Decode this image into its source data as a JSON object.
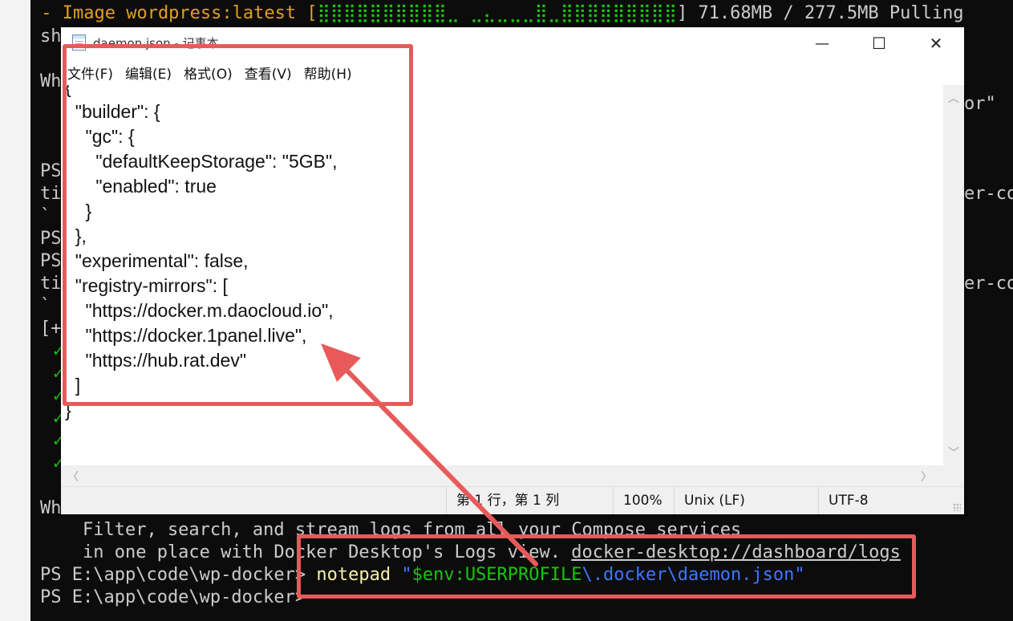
{
  "terminal": {
    "pull_line": {
      "prefix": " - Image wordpress:latest [",
      "bar": "⣿⣿⣿⣿⣿⣿⣿⣿⣿⣿⣀ ⣀⣄⣀⣀⣀⣿⣀⣿⣿⣿⣿⣿⣿⣿⣿⣿",
      "suffix": "] 71.68MB / 277.5MB Pulling"
    },
    "left_fragments": {
      "l1": "sh",
      "l2": "Wh",
      "l3": "PS",
      "l4": "ti",
      "l5": "`",
      "l6": "PS",
      "l7": "PS",
      "l8": "ti",
      "l9": "`",
      "l10": "[+",
      "l11": "Wh"
    },
    "right_fragments": {
      "r1": "or\"",
      "r2": "er-co",
      "r3": "er-co"
    },
    "tip_line1": "    Filter, search, and stream logs from all your Compose services",
    "tip_line2_text": "    in one place with Docker Desktop's Logs view. ",
    "tip_line2_link": "docker-desktop://dashboard/logs",
    "prompt": "PS E:\\app\\code\\wp-docker> ",
    "cmd_name": "notepad",
    "cmd_quote_open": " \"",
    "cmd_var": "$env:USERPROFILE",
    "cmd_path": "\\.docker\\daemon.json",
    "cmd_quote_close": "\"",
    "prompt2": "PS E:\\app\\code\\wp-docker>"
  },
  "notepad": {
    "title": "daemon.json - 记事本",
    "controls": {
      "minimize": "—",
      "maximize": "☐",
      "close": "✕"
    },
    "menus": [
      "文件(F)",
      "编辑(E)",
      "格式(O)",
      "查看(V)",
      "帮助(H)"
    ],
    "content": "{\n  \"builder\": {\n    \"gc\": {\n      \"defaultKeepStorage\": \"5GB\",\n      \"enabled\": true\n    }\n  },\n  \"experimental\": false,\n  \"registry-mirrors\": [\n    \"https://docker.m.daocloud.io\",\n    \"https://docker.1panel.live\",\n    \"https://hub.rat.dev\"\n  ]\n}",
    "status": {
      "position": "第 1 行，第 1 列",
      "zoom": "100%",
      "line_ending": "Unix (LF)",
      "encoding": "UTF-8"
    }
  },
  "annotation_color": "#e85a5a"
}
